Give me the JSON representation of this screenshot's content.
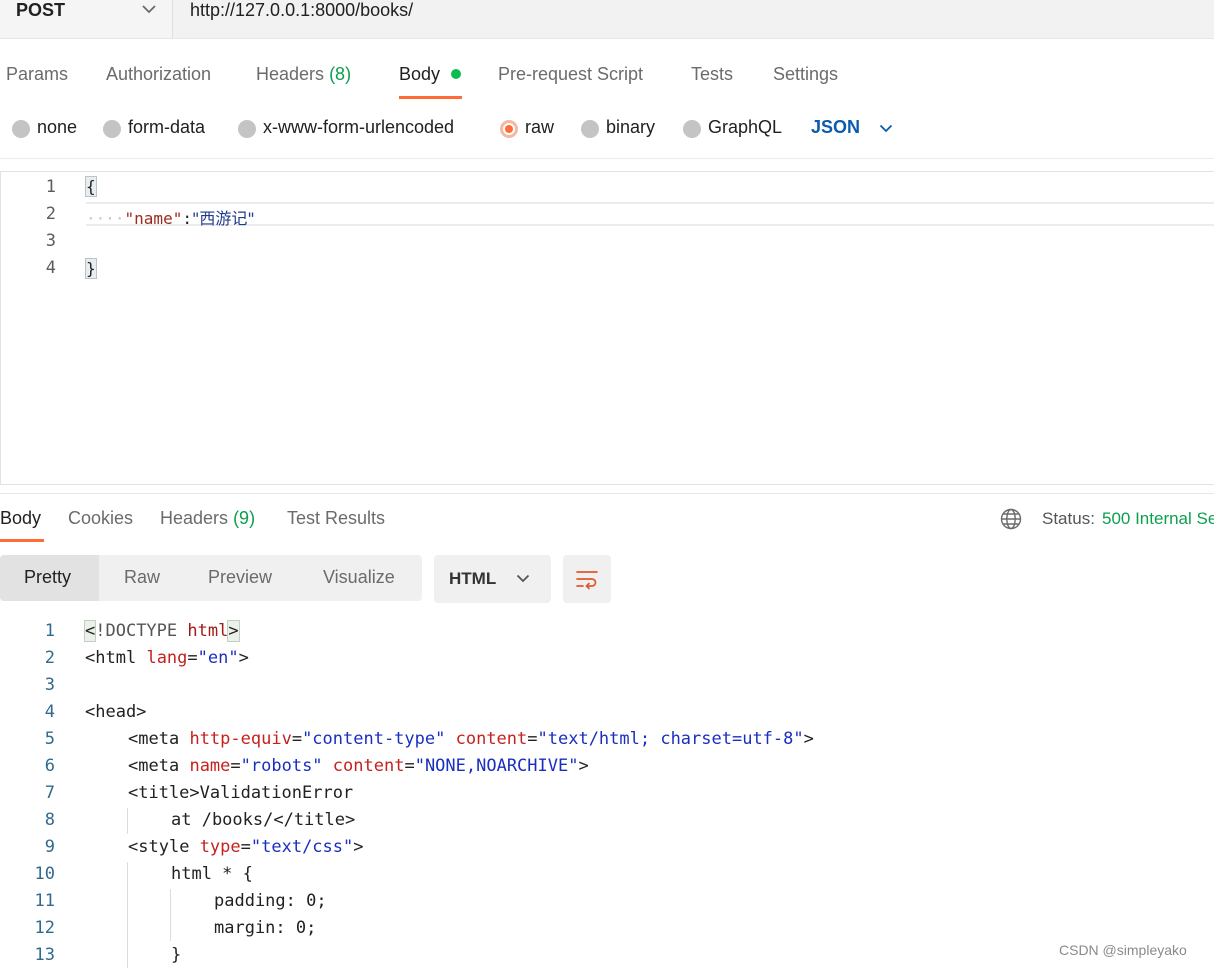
{
  "request": {
    "method": "POST",
    "url": "http://127.0.0.1:8000/books/",
    "tabs": {
      "params": "Params",
      "authorization": "Authorization",
      "headers": "Headers",
      "headers_count": "(8)",
      "body": "Body",
      "pre_request": "Pre-request Script",
      "tests": "Tests",
      "settings": "Settings"
    },
    "body_types": {
      "none": "none",
      "form_data": "form-data",
      "urlencoded": "x-www-form-urlencoded",
      "raw": "raw",
      "binary": "binary",
      "graphql": "GraphQL",
      "selected": "raw",
      "format": "JSON"
    },
    "editor": {
      "line_numbers": [
        "1",
        "2",
        "3",
        "4"
      ],
      "open_brace": "{",
      "indent_dots": "····",
      "key": "\"name\"",
      "colon": ":",
      "value": "\"西游记\"",
      "close_brace": "}"
    }
  },
  "response": {
    "tabs": {
      "body": "Body",
      "cookies": "Cookies",
      "headers": "Headers",
      "headers_count": "(9)",
      "test_results": "Test Results"
    },
    "status_label": "Status:",
    "status_value": "500 Internal Se",
    "view_modes": {
      "pretty": "Pretty",
      "raw": "Raw",
      "preview": "Preview",
      "visualize": "Visualize",
      "selected": "Pretty"
    },
    "format": "HTML",
    "code": {
      "line_numbers": [
        "1",
        "2",
        "3",
        "4",
        "5",
        "6",
        "7",
        "8",
        "9",
        "10",
        "11",
        "12",
        "13"
      ],
      "l1_a": "<",
      "l1_b": "!DOCTYPE",
      "l1_c": "html",
      "l1_d": ">",
      "l2_open": "<",
      "l2_tag": "html",
      "l2_attr": "lang",
      "l2_eq": "=",
      "l2_val": "\"en\"",
      "l2_close": ">",
      "l4": "<head>",
      "l5_open": "<",
      "l5_tag": "meta",
      "l5_a1": "http-equiv",
      "l5_v1": "\"content-type\"",
      "l5_a2": "content",
      "l5_v2": "\"text/html; charset=utf-8\"",
      "l5_close": ">",
      "l6_open": "<",
      "l6_tag": "meta",
      "l6_a1": "name",
      "l6_v1": "\"robots\"",
      "l6_a2": "content",
      "l6_v2": "\"NONE,NOARCHIVE\"",
      "l6_close": ">",
      "l7": "<title>ValidationError",
      "l8": "at /books/</title>",
      "l9_open": "<",
      "l9_tag": "style",
      "l9_attr": "type",
      "l9_val": "\"text/css\"",
      "l9_close": ">",
      "l10": "html * {",
      "l11": "padding: 0;",
      "l12": "margin: 0;",
      "l13": "}"
    }
  },
  "watermark": "CSDN @simpleyako",
  "colors": {
    "accent": "#ff6c37",
    "success": "#0c9f4e",
    "link_blue": "#0b5cad"
  }
}
